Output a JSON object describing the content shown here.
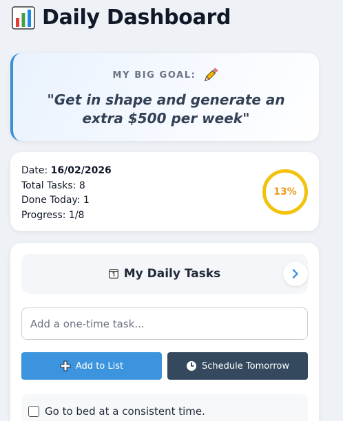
{
  "header": {
    "title": "Daily Dashboard",
    "icon": "bar-chart-icon"
  },
  "goal": {
    "label": "MY BIG GOAL:",
    "icon": "pencil-icon",
    "text": "\"Get in shape and generate an extra $500 per week\""
  },
  "stats": {
    "date_label": "Date:",
    "date_value": "16/02/2026",
    "total_tasks": "Total Tasks: 8",
    "done_today": "Done Today: 1",
    "progress": "Progress: 1/8",
    "progress_percent": "13%",
    "progress_fraction": 0.125
  },
  "tasks": {
    "title": "My Daily Tasks",
    "header_icon": "calendar-icon",
    "next_icon": "chevron-right-icon",
    "input_placeholder": "Add a one-time task...",
    "add_label": "Add to List",
    "schedule_label": "Schedule Tomorrow",
    "items": [
      {
        "label": "Go to bed at a consistent time.",
        "checked": false
      }
    ]
  },
  "colors": {
    "accent": "#3b94dd",
    "dark_button": "#34495e",
    "progress_ring": "#f2c20c",
    "progress_text": "#ee9a1a"
  }
}
